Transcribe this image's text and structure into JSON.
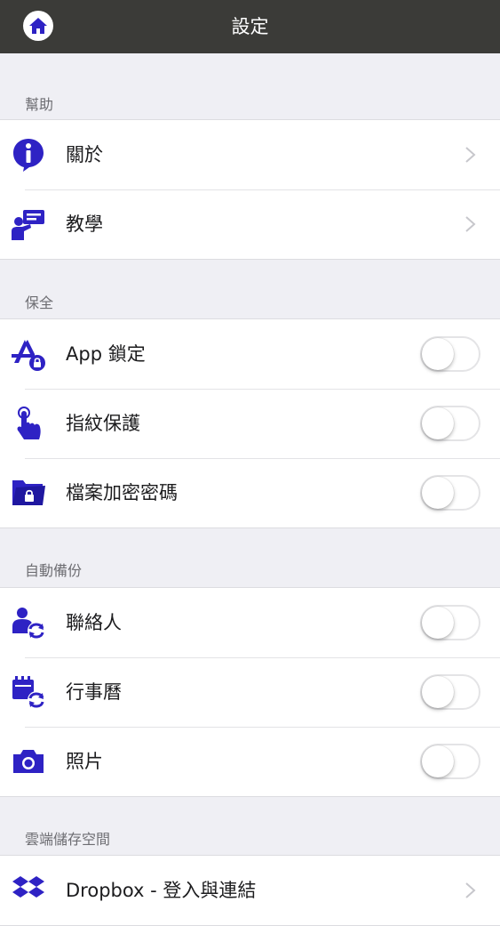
{
  "navbar": {
    "title": "設定",
    "home_icon": "home-icon"
  },
  "colors": {
    "navbar_bg": "#3b3b38",
    "icon_blue": "#2e22c4",
    "background": "#efeff4"
  },
  "sections": {
    "help": {
      "header": "幫助",
      "items": [
        {
          "label": "關於",
          "icon": "info-icon",
          "control": "chevron"
        },
        {
          "label": "教學",
          "icon": "tutorial-icon",
          "control": "chevron"
        }
      ]
    },
    "security": {
      "header": "保全",
      "items": [
        {
          "label": "App 鎖定",
          "icon": "app-lock-icon",
          "control": "toggle",
          "on": false
        },
        {
          "label": "指紋保護",
          "icon": "fingerprint-icon",
          "control": "toggle",
          "on": false
        },
        {
          "label": "檔案加密密碼",
          "icon": "folder-lock-icon",
          "control": "toggle",
          "on": false
        }
      ]
    },
    "backup": {
      "header": "自動備份",
      "items": [
        {
          "label": "聯絡人",
          "icon": "contacts-sync-icon",
          "control": "toggle",
          "on": false
        },
        {
          "label": "行事曆",
          "icon": "calendar-sync-icon",
          "control": "toggle",
          "on": false
        },
        {
          "label": "照片",
          "icon": "camera-icon",
          "control": "toggle",
          "on": false
        }
      ]
    },
    "cloud": {
      "header": "雲端儲存空間",
      "items": [
        {
          "label": "Dropbox - 登入與連結",
          "icon": "dropbox-icon",
          "control": "chevron"
        }
      ]
    }
  }
}
